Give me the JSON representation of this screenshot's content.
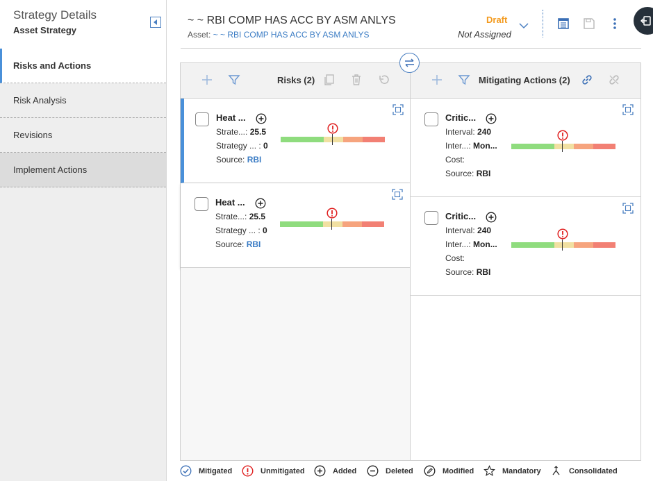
{
  "sidebar": {
    "title": "Strategy Details",
    "subtitle": "Asset Strategy",
    "items": [
      {
        "label": "Risks and Actions"
      },
      {
        "label": "Risk Analysis"
      },
      {
        "label": "Revisions"
      },
      {
        "label": "Implement Actions"
      }
    ]
  },
  "header": {
    "title": "~ ~ RBI COMP HAS ACC BY ASM ANLYS",
    "asset_label": "Asset:",
    "asset_value": "~ ~ RBI COMP HAS ACC BY ASM ANLYS",
    "status": "Draft",
    "assignment": "Not Assigned"
  },
  "risks_panel": {
    "title": "Risks (2)",
    "cards": [
      {
        "name": "Heat ...",
        "line1_label": "Strate...:",
        "line1_value": "25.5",
        "line2_label": "Strategy ... :",
        "line2_value": "0",
        "source_label": "Source:",
        "source_value": "RBI"
      },
      {
        "name": "Heat ...",
        "line1_label": "Strate...:",
        "line1_value": "25.5",
        "line2_label": "Strategy ... :",
        "line2_value": "0",
        "source_label": "Source:",
        "source_value": "RBI"
      }
    ]
  },
  "actions_panel": {
    "title": "Mitigating Actions (2)",
    "cards": [
      {
        "name": "Critic...",
        "interval_label": "Interval:",
        "interval_value": "240",
        "units_label": "Inter...:",
        "units_value": "Mon...",
        "cost_label": "Cost:",
        "source_label": "Source:",
        "source_value": "RBI"
      },
      {
        "name": "Critic...",
        "interval_label": "Interval:",
        "interval_value": "240",
        "units_label": "Inter...:",
        "units_value": "Mon...",
        "cost_label": "Cost:",
        "source_label": "Source:",
        "source_value": "RBI"
      }
    ]
  },
  "legend": [
    {
      "label": "Mitigated",
      "icon": "check-circle-icon"
    },
    {
      "label": "Unmitigated",
      "icon": "exclamation-circle-icon"
    },
    {
      "label": "Added",
      "icon": "plus-circle-icon"
    },
    {
      "label": "Deleted",
      "icon": "minus-circle-icon"
    },
    {
      "label": "Modified",
      "icon": "pencil-circle-icon"
    },
    {
      "label": "Mandatory",
      "icon": "star-icon"
    },
    {
      "label": "Consolidated",
      "icon": "merge-icon"
    }
  ],
  "colors": {
    "accent": "#4a90d9",
    "draft": "#f39a1e",
    "link": "#3b7cc4",
    "risk_green": "#8fdc7e",
    "risk_yellow": "#f1e0a2",
    "risk_orange": "#f6a47e",
    "risk_red": "#f28074",
    "unmitigated": "#e02020"
  }
}
